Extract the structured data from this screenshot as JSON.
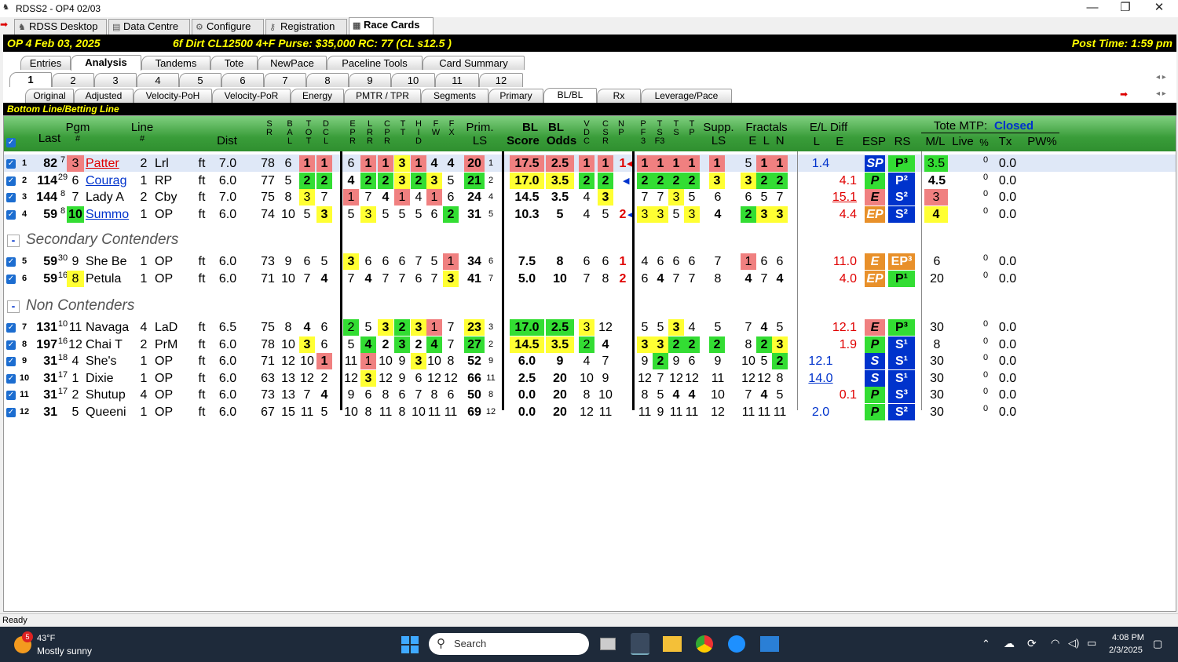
{
  "window": {
    "title": "RDSS2 - OP4  02/03",
    "minimize": "—",
    "restore": "❐",
    "close": "✕"
  },
  "main_tabs": [
    {
      "label": "RDSS Desktop",
      "icon": "horse-icon"
    },
    {
      "label": "Data Centre",
      "icon": "db-icon"
    },
    {
      "label": "Configure",
      "icon": "gear-icon"
    },
    {
      "label": "Registration",
      "icon": "key-icon"
    },
    {
      "label": "Race Cards",
      "icon": "card-icon"
    }
  ],
  "info": {
    "track": "OP 4  Feb 03, 2025",
    "race": "6f  Dirt   CL12500  4+F   Purse: $35,000   RC: 77  (CL s12.5 )",
    "post": "Post Time: 1:59 pm"
  },
  "view_tabs": [
    "Entries",
    "Analysis",
    "Tandems",
    "Tote",
    "NewPace",
    "Paceline Tools",
    "Card Summary"
  ],
  "race_tabs": [
    "1",
    "2",
    "3",
    "4",
    "5",
    "6",
    "7",
    "8",
    "9",
    "10",
    "11",
    "12"
  ],
  "sub_tabs": [
    "Original",
    "Adjusted",
    "Velocity-PoH",
    "Velocity-PoR",
    "Energy",
    "PMTR / TPR",
    "Segments",
    "Primary",
    "BL/BL",
    "Rx",
    "Leverage/Pace"
  ],
  "section_title": "Bottom Line/Betting Line",
  "headers": {
    "last": "Last",
    "pgm": "Pgm",
    "pgm_sub": "#",
    "line": "Line",
    "line_sub": "#",
    "dist": "Dist",
    "sr": "S\nR",
    "bal": "B\nA\nL",
    "tot": "T\nO\nT",
    "dcl": "D\nC\nL",
    "epr": "E\nP\nR",
    "lrr": "L\nR\nR",
    "cpr": "C\nP\nR",
    "tt": "T\nT",
    "hid": "H\nI\nD",
    "fw": "F\nW",
    "fx": "F\nX",
    "prim": "Prim.",
    "prim_sub": "LS",
    "bl_score": "BL",
    "bl_score2": "Score",
    "bl_odds": "BL",
    "bl_odds2": "Odds",
    "vdc": "V\nD\nC",
    "csr": "C\nS\nR",
    "np": "N\nP",
    "pf3": "P\nF\n3",
    "tsf3": "T\nS\nF3",
    "ts": "T\nS",
    "tp": "T\nP",
    "supp": "Supp.",
    "supp_sub": "LS",
    "fract": "Fractals",
    "fract_sub": "E  L  N",
    "eldiff": "E/L Diff",
    "eldiff_sub": "L     E",
    "esp": "ESP",
    "rs": "RS",
    "tote": "Tote MTP:",
    "tote_status": "Closed",
    "ml": "M/L",
    "live": "Live",
    "pct": "%",
    "tx": "Tx",
    "pw": "PW%"
  },
  "groups": [
    {
      "label": "",
      "rows": [
        [
          "1",
          "82",
          "7",
          "3",
          "Patter",
          "2",
          "Lrl",
          "ft",
          "7.0",
          "78",
          "6",
          "1",
          "1",
          "6",
          "1",
          "1",
          "3",
          "1",
          "4",
          "4",
          "20",
          "1",
          "17.5",
          "2.5",
          "1",
          "1",
          "1",
          "1",
          "1",
          "1",
          "1",
          "1",
          "5",
          "1",
          "1",
          "1.4",
          "",
          "SP",
          "P³",
          "3.5",
          "0",
          "0.0"
        ],
        [
          "2",
          "114",
          "29",
          "6",
          "Courag",
          "1",
          "RP",
          "ft",
          "6.0",
          "77",
          "5",
          "2",
          "2",
          "4",
          "2",
          "2",
          "3",
          "2",
          "3",
          "5",
          "21",
          "2",
          "17.0",
          "3.5",
          "2",
          "2",
          "",
          "2",
          "2",
          "2",
          "2",
          "3",
          "3",
          "2",
          "2",
          "",
          "4.1",
          "P",
          "P²",
          "4.5",
          "0",
          "0.0"
        ],
        [
          "3",
          "144",
          "8",
          "7",
          "Lady A",
          "2",
          "Cby",
          "ft",
          "7.0",
          "75",
          "8",
          "3",
          "7",
          "1",
          "7",
          "4",
          "1",
          "4",
          "1",
          "6",
          "24",
          "4",
          "14.5",
          "3.5",
          "4",
          "3",
          "",
          "7",
          "7",
          "3",
          "5",
          "6",
          "6",
          "5",
          "7",
          "",
          "15.1",
          "E",
          "S²",
          "3",
          "0",
          "0.0"
        ],
        [
          "4",
          "59",
          "8",
          "10",
          "Summo",
          "1",
          "OP",
          "ft",
          "6.0",
          "74",
          "10",
          "5",
          "3",
          "5",
          "3",
          "5",
          "5",
          "5",
          "6",
          "2",
          "31",
          "5",
          "10.3",
          "5",
          "4",
          "5",
          "2",
          "3",
          "3",
          "5",
          "3",
          "4",
          "2",
          "3",
          "3",
          "",
          "4.4",
          "EP",
          "S²",
          "4",
          "0",
          "0.0"
        ]
      ]
    },
    {
      "label": "Secondary Contenders",
      "rows": [
        [
          "5",
          "59",
          "30",
          "9",
          "She Be",
          "1",
          "OP",
          "ft",
          "6.0",
          "73",
          "9",
          "6",
          "5",
          "3",
          "6",
          "6",
          "6",
          "7",
          "5",
          "1",
          "34",
          "6",
          "7.5",
          "8",
          "6",
          "6",
          "1",
          "4",
          "6",
          "6",
          "6",
          "7",
          "1",
          "6",
          "6",
          "",
          "11.0",
          "E",
          "EP³",
          "6",
          "0",
          "0.0"
        ],
        [
          "6",
          "59",
          "16",
          "8",
          "Petula",
          "1",
          "OP",
          "ft",
          "6.0",
          "71",
          "10",
          "7",
          "4",
          "7",
          "4",
          "7",
          "7",
          "6",
          "7",
          "3",
          "41",
          "7",
          "5.0",
          "10",
          "7",
          "8",
          "2",
          "6",
          "4",
          "7",
          "7",
          "8",
          "4",
          "7",
          "4",
          "",
          "4.0",
          "EP",
          "P¹",
          "20",
          "0",
          "0.0"
        ]
      ]
    },
    {
      "label": "Non Contenders",
      "rows": [
        [
          "7",
          "131",
          "10",
          "11",
          "Navaga",
          "4",
          "LaD",
          "ft",
          "6.5",
          "75",
          "8",
          "4",
          "6",
          "2",
          "5",
          "3",
          "2",
          "3",
          "1",
          "7",
          "23",
          "3",
          "17.0",
          "2.5",
          "3",
          "12",
          "",
          "5",
          "5",
          "3",
          "4",
          "5",
          "7",
          "4",
          "5",
          "",
          "12.1",
          "E",
          "P³",
          "30",
          "0",
          "0.0"
        ],
        [
          "8",
          "197",
          "16",
          "12",
          "Chai T",
          "2",
          "PrM",
          "ft",
          "6.0",
          "78",
          "10",
          "3",
          "6",
          "5",
          "4",
          "2",
          "3",
          "2",
          "4",
          "7",
          "27",
          "2",
          "14.5",
          "3.5",
          "2",
          "4",
          "",
          "3",
          "3",
          "2",
          "2",
          "2",
          "8",
          "2",
          "3",
          "",
          "1.9",
          "P",
          "S¹",
          "8",
          "0",
          "0.0"
        ],
        [
          "9",
          "31",
          "18",
          "4",
          "She's",
          "1",
          "OP",
          "ft",
          "6.0",
          "71",
          "12",
          "10",
          "1",
          "11",
          "1",
          "10",
          "9",
          "3",
          "10",
          "8",
          "52",
          "9",
          "6.0",
          "9",
          "4",
          "7",
          "",
          "9",
          "2",
          "9",
          "6",
          "9",
          "10",
          "5",
          "2",
          "12.1",
          "",
          "S",
          "S¹",
          "30",
          "0",
          "0.0"
        ],
        [
          "10",
          "31",
          "17",
          "1",
          "Dixie",
          "1",
          "OP",
          "ft",
          "6.0",
          "63",
          "13",
          "12",
          "2",
          "12",
          "3",
          "12",
          "9",
          "6",
          "12",
          "12",
          "66",
          "11",
          "2.5",
          "20",
          "10",
          "9",
          "",
          "12",
          "7",
          "12",
          "12",
          "11",
          "12",
          "12",
          "8",
          "14.0",
          "",
          "S",
          "S¹",
          "30",
          "0",
          "0.0"
        ],
        [
          "11",
          "31",
          "17",
          "2",
          "Shutup",
          "4",
          "OP",
          "ft",
          "6.0",
          "73",
          "13",
          "7",
          "4",
          "9",
          "6",
          "8",
          "6",
          "7",
          "8",
          "6",
          "50",
          "8",
          "0.0",
          "20",
          "8",
          "10",
          "",
          "8",
          "5",
          "4",
          "4",
          "10",
          "7",
          "4",
          "5",
          "",
          "0.1",
          "P",
          "S³",
          "30",
          "0",
          "0.0"
        ],
        [
          "12",
          "31",
          "",
          "5",
          "Queeni",
          "1",
          "OP",
          "ft",
          "6.0",
          "67",
          "15",
          "11",
          "5",
          "10",
          "8",
          "11",
          "8",
          "10",
          "11",
          "11",
          "69",
          "12",
          "0.0",
          "20",
          "12",
          "11",
          "",
          "11",
          "9",
          "11",
          "11",
          "12",
          "11",
          "11",
          "11",
          "2.0",
          "",
          "P",
          "S²",
          "30",
          "0",
          "0.0"
        ]
      ]
    }
  ],
  "status": "Ready",
  "taskbar": {
    "temp": "43°F",
    "weather": "Mostly sunny",
    "badge": "5",
    "search": "Search",
    "time": "4:08 PM",
    "date": "2/3/2025"
  },
  "colors": {
    "accent_green": "#33dd33",
    "yellow": "#ffff33",
    "red": "#f08080",
    "blue": "#0033cc",
    "orange": "#e8902a"
  }
}
